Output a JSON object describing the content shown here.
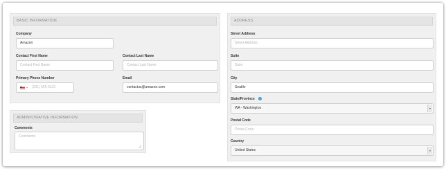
{
  "basic": {
    "header": "BASIC INFORMATION",
    "company_label": "Company",
    "company_value": "Amazon",
    "first_name_label": "Contact First Name",
    "first_name_placeholder": "Contact First Name",
    "last_name_label": "Contact Last Name",
    "last_name_placeholder": "Contact Last Name",
    "phone_label": "Primary Phone Number",
    "phone_placeholder": "(201) 555-0123",
    "email_label": "Email",
    "email_value": "contactus@amazon.com"
  },
  "admin": {
    "header": "ADMINISTRATIVE INFORMATION",
    "comments_label": "Comments",
    "comments_placeholder": "Comments"
  },
  "address": {
    "header": "ADDRESS",
    "street_label": "Street Address",
    "street_placeholder": "Street Address",
    "suite_label": "Suite",
    "suite_placeholder": "Suite",
    "city_label": "City",
    "city_value": "Seattle",
    "state_label": "State/Province",
    "state_value": "WA - Washington",
    "postal_label": "Postal Code",
    "postal_placeholder": "Postal Code",
    "country_label": "Country",
    "country_value": "United States"
  },
  "icons": {
    "info": "info-icon",
    "flag": "us-flag-icon"
  },
  "colors": {
    "panel_bg": "#f0f0f0",
    "header_bg": "#e4e4e4",
    "info_blue": "#2f9ad7"
  }
}
